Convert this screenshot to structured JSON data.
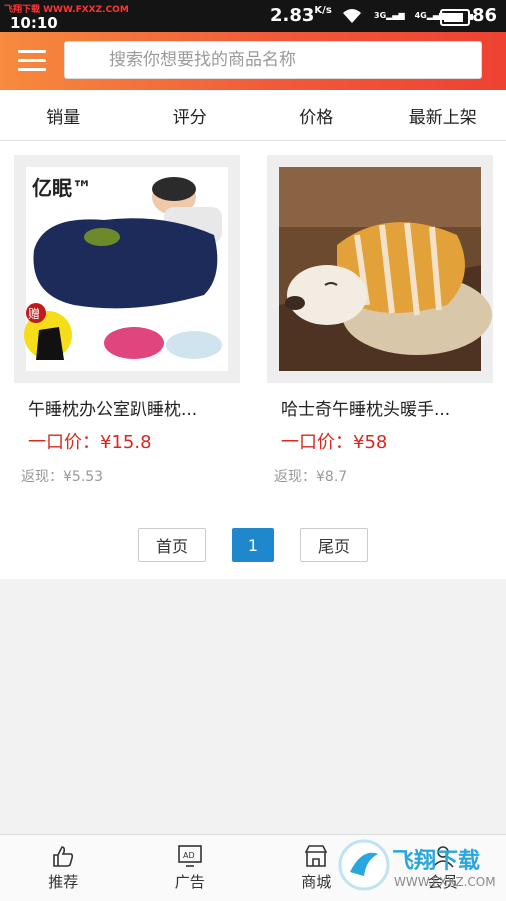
{
  "status": {
    "watermark": "飞翔下载 WWW.FXXZ.COM",
    "time": "10:10",
    "speed": "2.83",
    "speed_unit": "K/s",
    "signal1": "3G",
    "signal2": "4G",
    "battery": "86",
    "battery_level": 0.86
  },
  "header": {
    "search_placeholder": "搜索你想要找的商品名称"
  },
  "sort": [
    "销量",
    "评分",
    "价格",
    "最新上架"
  ],
  "products": [
    {
      "brand": "亿眠™",
      "gift": "赠",
      "title": "午睡枕办公室趴睡枕...",
      "price": "一口价：¥15.8",
      "rebate": "返现：¥5.53"
    },
    {
      "title": "哈士奇午睡枕头暖手...",
      "price": "一口价：¥58",
      "rebate": "返现：¥8.7"
    }
  ],
  "pager": {
    "first": "首页",
    "current": "1",
    "last": "尾页"
  },
  "nav": [
    "推荐",
    "广告",
    "商城",
    "会员"
  ],
  "watermark": "飞翔下载 WWW.FXXZ.COM",
  "colors": {
    "accent": "#ee4232",
    "price": "#d9281f",
    "pager_active": "#1f87cc"
  }
}
